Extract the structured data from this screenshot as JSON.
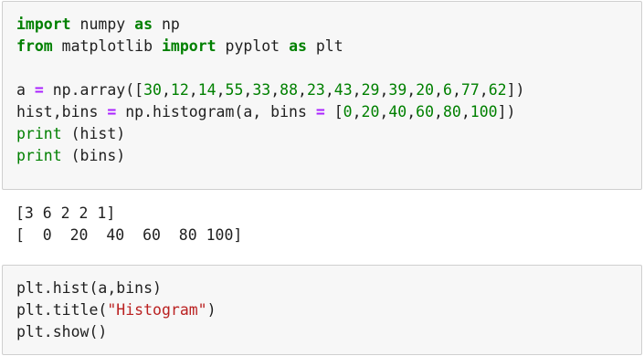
{
  "cell1": {
    "lines": [
      [
        {
          "t": "import",
          "c": "kw"
        },
        {
          "t": " numpy ",
          "c": "plain"
        },
        {
          "t": "as",
          "c": "kw"
        },
        {
          "t": " np",
          "c": "plain"
        }
      ],
      [
        {
          "t": "from",
          "c": "kw"
        },
        {
          "t": " matplotlib ",
          "c": "plain"
        },
        {
          "t": "import",
          "c": "kw"
        },
        {
          "t": " pyplot ",
          "c": "plain"
        },
        {
          "t": "as",
          "c": "kw"
        },
        {
          "t": " plt",
          "c": "plain"
        }
      ],
      [],
      [
        {
          "t": "a ",
          "c": "plain"
        },
        {
          "t": "=",
          "c": "op"
        },
        {
          "t": " np.array([",
          "c": "plain"
        },
        {
          "t": "30",
          "c": "num"
        },
        {
          "t": ",",
          "c": "plain"
        },
        {
          "t": "12",
          "c": "num"
        },
        {
          "t": ",",
          "c": "plain"
        },
        {
          "t": "14",
          "c": "num"
        },
        {
          "t": ",",
          "c": "plain"
        },
        {
          "t": "55",
          "c": "num"
        },
        {
          "t": ",",
          "c": "plain"
        },
        {
          "t": "33",
          "c": "num"
        },
        {
          "t": ",",
          "c": "plain"
        },
        {
          "t": "88",
          "c": "num"
        },
        {
          "t": ",",
          "c": "plain"
        },
        {
          "t": "23",
          "c": "num"
        },
        {
          "t": ",",
          "c": "plain"
        },
        {
          "t": "43",
          "c": "num"
        },
        {
          "t": ",",
          "c": "plain"
        },
        {
          "t": "29",
          "c": "num"
        },
        {
          "t": ",",
          "c": "plain"
        },
        {
          "t": "39",
          "c": "num"
        },
        {
          "t": ",",
          "c": "plain"
        },
        {
          "t": "20",
          "c": "num"
        },
        {
          "t": ",",
          "c": "plain"
        },
        {
          "t": "6",
          "c": "num"
        },
        {
          "t": ",",
          "c": "plain"
        },
        {
          "t": "77",
          "c": "num"
        },
        {
          "t": ",",
          "c": "plain"
        },
        {
          "t": "62",
          "c": "num"
        },
        {
          "t": "])",
          "c": "plain"
        }
      ],
      [
        {
          "t": "hist,bins ",
          "c": "plain"
        },
        {
          "t": "=",
          "c": "op"
        },
        {
          "t": " np.histogram(a, bins ",
          "c": "plain"
        },
        {
          "t": "=",
          "c": "op"
        },
        {
          "t": " [",
          "c": "plain"
        },
        {
          "t": "0",
          "c": "num"
        },
        {
          "t": ",",
          "c": "plain"
        },
        {
          "t": "20",
          "c": "num"
        },
        {
          "t": ",",
          "c": "plain"
        },
        {
          "t": "40",
          "c": "num"
        },
        {
          "t": ",",
          "c": "plain"
        },
        {
          "t": "60",
          "c": "num"
        },
        {
          "t": ",",
          "c": "plain"
        },
        {
          "t": "80",
          "c": "num"
        },
        {
          "t": ",",
          "c": "plain"
        },
        {
          "t": "100",
          "c": "num"
        },
        {
          "t": "])",
          "c": "plain"
        }
      ],
      [
        {
          "t": "print",
          "c": "bi"
        },
        {
          "t": " (hist)",
          "c": "plain"
        }
      ],
      [
        {
          "t": "print",
          "c": "bi"
        },
        {
          "t": " (bins)",
          "c": "plain"
        }
      ]
    ]
  },
  "output1": {
    "lines": [
      "[3 6 2 2 1]",
      "[  0  20  40  60  80 100]"
    ]
  },
  "cell2": {
    "lines": [
      [
        {
          "t": "plt.hist(a,bins)",
          "c": "plain"
        }
      ],
      [
        {
          "t": "plt.title(",
          "c": "plain"
        },
        {
          "t": "\"Histogram\"",
          "c": "str"
        },
        {
          "t": ")",
          "c": "plain"
        }
      ],
      [
        {
          "t": "plt.show()",
          "c": "plain"
        }
      ]
    ]
  },
  "colors": {
    "keyword": "#008000",
    "operator": "#aa22ff",
    "number": "#008000",
    "string": "#ba2121",
    "cell_bg": "#f7f7f7",
    "cell_border": "#cfcfcf"
  }
}
